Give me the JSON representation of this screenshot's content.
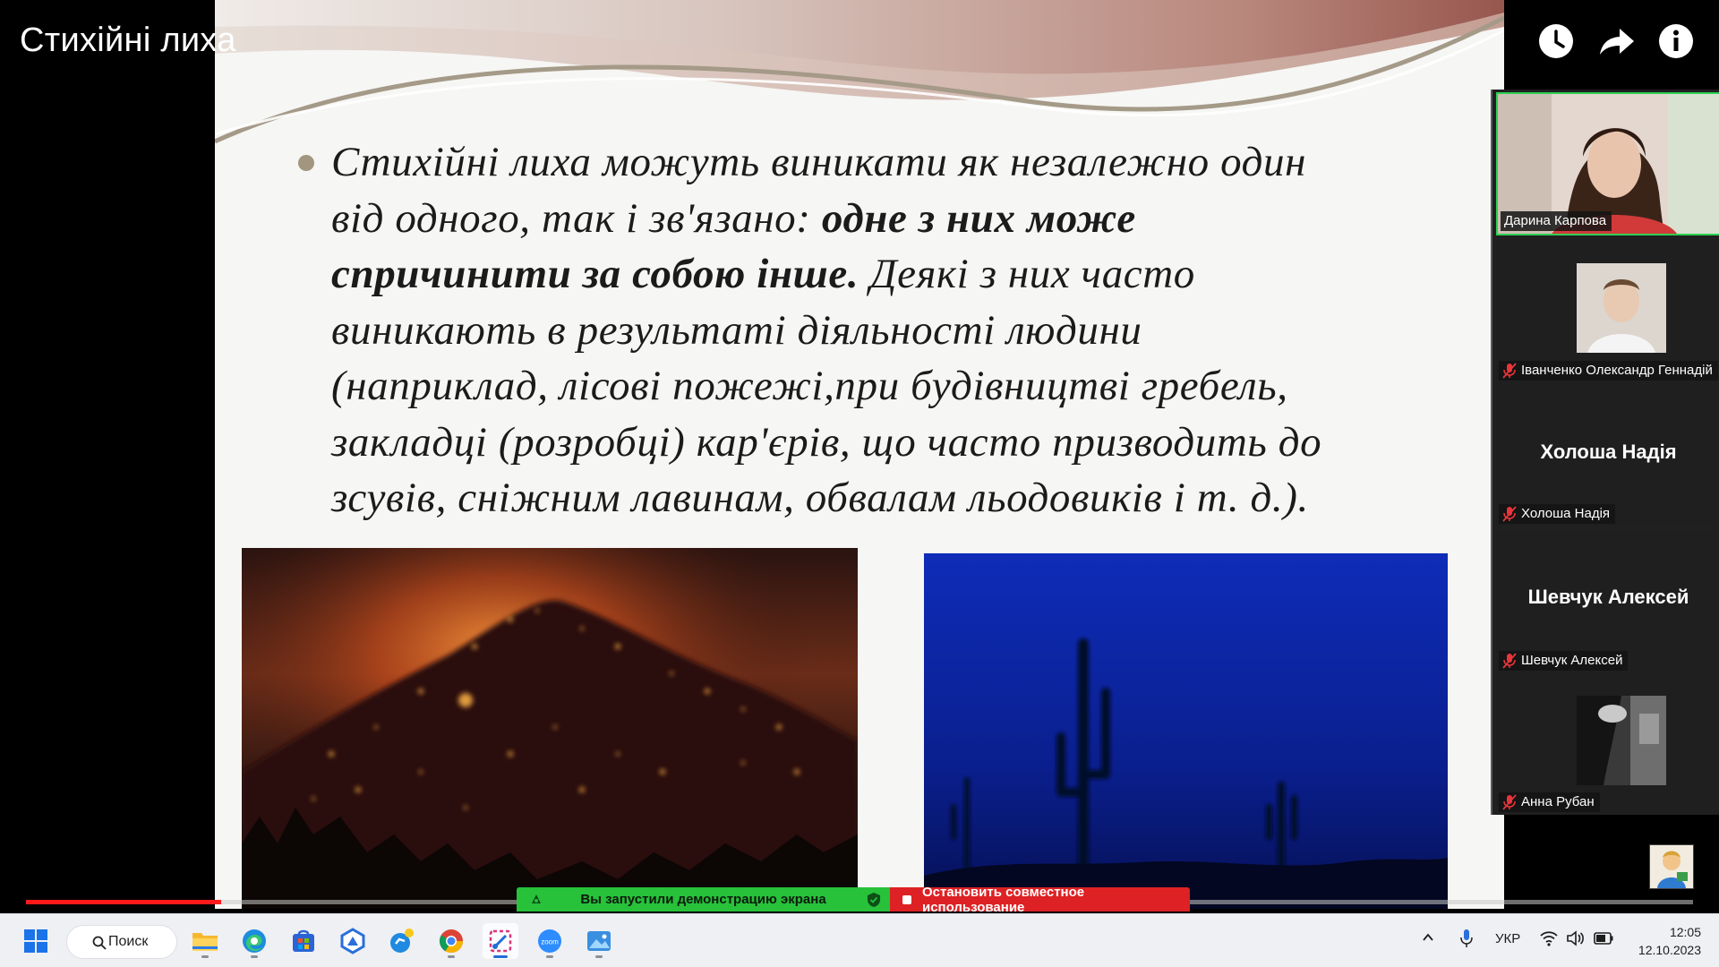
{
  "video": {
    "title": "Стихійні лиха",
    "progress_fraction": 0.117
  },
  "controls": {
    "watch_later_icon": "clock-icon",
    "share_icon": "share-arrow-icon",
    "info_icon": "info-icon"
  },
  "slide": {
    "line1": "Стихійні лиха можуть виникати як незалежно один",
    "line2a": "від одного, так і зв'язано: ",
    "line2b": "одне з них може",
    "line3a": "спричинити за собою інше.",
    "line3b": " Деякі з них часто",
    "line4": "виникають в результаті діяльності людини",
    "line5": "(наприклад, лісові пожежі,при будівництві гребель,",
    "line6": "закладці (розробці) кар'єрів, що часто призводить до",
    "line7": "зсувів, сніжним лавинам, обвалам льодовиків і т. д.)."
  },
  "participants": [
    {
      "name": "Дарина Карпова",
      "muted": false,
      "video": true
    },
    {
      "name": "Іванченко Олександр Геннадій",
      "muted": true,
      "video": true
    },
    {
      "name": "Холоша Надія",
      "center_label": "Холоша Надія",
      "muted": true,
      "video": false
    },
    {
      "name": "Шевчук Алексей",
      "center_label": "Шевчук Алексей",
      "muted": true,
      "video": false
    },
    {
      "name": "Анна Рубан",
      "muted": true,
      "video": true
    }
  ],
  "zoom_bar": {
    "status": "Вы запустили демонстрацию экрана",
    "stop": "Остановить совместное использование",
    "status_color": "#27c13a",
    "stop_color": "#dd2124"
  },
  "taskbar": {
    "search_placeholder": "Поиск",
    "language": "УКР",
    "time": "12:05",
    "date": "12.10.2023",
    "apps": [
      "windows-start-icon",
      "file-explorer-icon",
      "edge-icon",
      "store-icon",
      "app-icon",
      "app-icon",
      "chrome-icon",
      "snipping-tool-icon",
      "zoom-icon",
      "photos-icon"
    ]
  }
}
